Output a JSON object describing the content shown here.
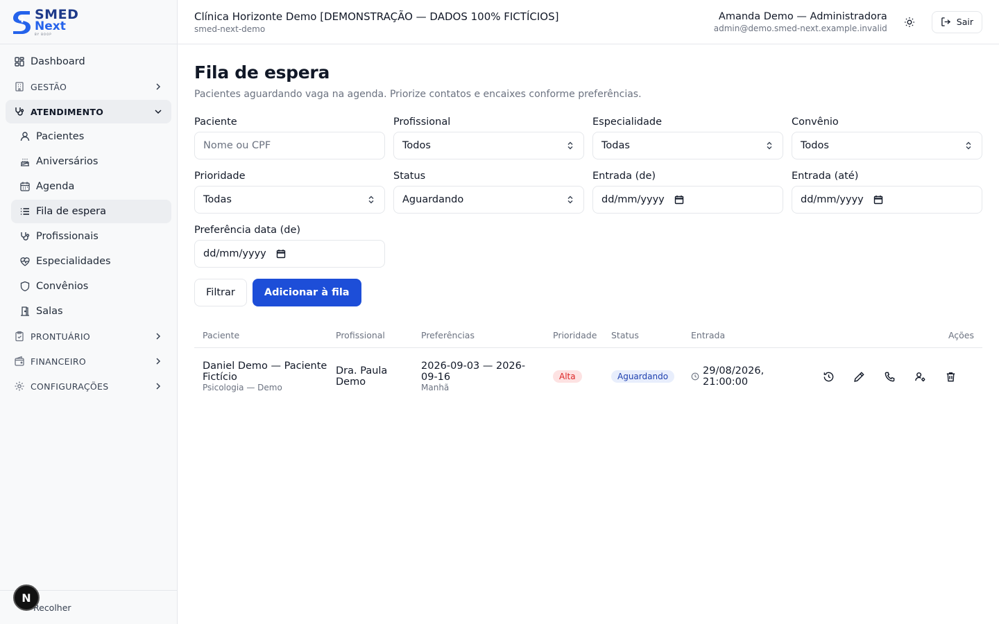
{
  "brand": {
    "line1": "SMED",
    "line2": "Next",
    "line3": "BY BOOP",
    "colors": {
      "primary": "#1d4ed8",
      "logo": "#2563eb"
    }
  },
  "sidebar": {
    "dashboard": "Dashboard",
    "sections": {
      "gestao": "GESTÃO",
      "atendimento": "ATENDIMENTO",
      "prontuario": "PRONTUÁRIO",
      "financeiro": "FINANCEIRO",
      "configuracoes": "CONFIGURAÇÕES"
    },
    "atendimento_items": [
      {
        "label": "Pacientes",
        "icon": "user-icon"
      },
      {
        "label": "Aniversários",
        "icon": "cake-icon"
      },
      {
        "label": "Agenda",
        "icon": "calendar-icon"
      },
      {
        "label": "Fila de espera",
        "icon": "list-icon"
      },
      {
        "label": "Profissionais",
        "icon": "stethoscope-icon"
      },
      {
        "label": "Especialidades",
        "icon": "heart-pulse-icon"
      },
      {
        "label": "Convênios",
        "icon": "shield-icon"
      },
      {
        "label": "Salas",
        "icon": "door-icon"
      }
    ],
    "collapse_label": "Recolher",
    "fab_label": "N"
  },
  "header": {
    "clinic_name": "Clínica Horizonte Demo [DEMONSTRAÇÃO — DADOS 100% FICTÍCIOS]",
    "clinic_slug": "smed-next-demo",
    "user_name": "Amanda Demo — Administradora",
    "user_email": "admin@demo.smed-next.example.invalid",
    "logout_label": "Sair"
  },
  "page": {
    "title": "Fila de espera",
    "subtitle": "Pacientes aguardando vaga na agenda. Priorize contatos e encaixes conforme preferências."
  },
  "filters": {
    "paciente": {
      "label": "Paciente",
      "placeholder": "Nome ou CPF",
      "value": ""
    },
    "profissional": {
      "label": "Profissional",
      "value": "Todos"
    },
    "especialidade": {
      "label": "Especialidade",
      "value": "Todas"
    },
    "convenio": {
      "label": "Convênio",
      "value": "Todos"
    },
    "prioridade": {
      "label": "Prioridade",
      "value": "Todas"
    },
    "status": {
      "label": "Status",
      "value": "Aguardando"
    },
    "entrada_de": {
      "label": "Entrada (de)",
      "value": "dd/mm/yyyy"
    },
    "entrada_ate": {
      "label": "Entrada (até)",
      "value": "dd/mm/yyyy"
    },
    "preferencia_de": {
      "label": "Preferência data (de)",
      "value": "dd/mm/yyyy"
    },
    "filter_button": "Filtrar",
    "add_button": "Adicionar à fila"
  },
  "table": {
    "columns": [
      "Paciente",
      "Profissional",
      "Preferências",
      "Prioridade",
      "Status",
      "Entrada",
      "Ações"
    ],
    "rows": [
      {
        "patient": "Daniel Demo — Paciente Fictício",
        "specialty": "Psicologia — Demo",
        "professional": "Dra. Paula Demo",
        "preference_range": "2026-09-03 — 2026-09-16",
        "preference_period": "Manhã",
        "priority": "Alta",
        "status": "Aguardando",
        "entry": "29/08/2026, 21:00:00"
      }
    ]
  }
}
